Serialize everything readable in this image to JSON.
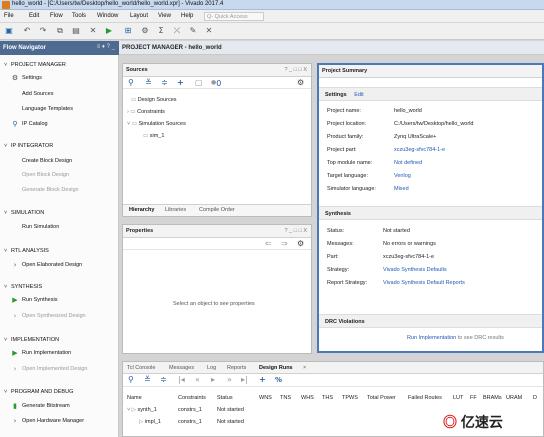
{
  "window": {
    "title": "hello_world - [C:/Users/tw/Desktop/hello_world/hello_world.xpr] - Vivado 2017.4"
  },
  "menu": {
    "items": [
      "File",
      "Edit",
      "Flow",
      "Tools",
      "Window",
      "Layout",
      "View",
      "Help"
    ],
    "search_placeholder": "Q- Quick Access"
  },
  "flow_navigator": {
    "title": "Flow Navigator",
    "controls": "≡ ♦ ? _",
    "project_manager": {
      "label": "PROJECT MANAGER",
      "settings": "Settings",
      "add_sources": "Add Sources",
      "language_templates": "Language Templates",
      "ip_catalog": "IP Catalog"
    },
    "ip_integrator": {
      "label": "IP INTEGRATOR",
      "create_block_design": "Create Block Design",
      "open_block_design": "Open Block Design",
      "generate_block_design": "Generate Block Design"
    },
    "simulation": {
      "label": "SIMULATION",
      "run_simulation": "Run Simulation"
    },
    "rtl_analysis": {
      "label": "RTL ANALYSIS",
      "open_elaborated_design": "Open Elaborated Design"
    },
    "synthesis": {
      "label": "SYNTHESIS",
      "run_synthesis": "Run Synthesis",
      "open_synthesized_design": "Open Synthesized Design"
    },
    "implementation": {
      "label": "IMPLEMENTATION",
      "run_implementation": "Run Implementation",
      "open_implemented_design": "Open Implemented Design"
    },
    "program_debug": {
      "label": "PROGRAM AND DEBUG",
      "generate_bitstream": "Generate Bitstream",
      "open_hardware_manager": "Open Hardware Manager"
    }
  },
  "main": {
    "header": "PROJECT MANAGER - hello_world"
  },
  "sources": {
    "title": "Sources",
    "window_controls": "? _ □ □ X",
    "count": "0",
    "tree": {
      "design_sources": "Design Sources",
      "constraints": "Constraints",
      "simulation_sources": "Simulation Sources",
      "sim_1": "sim_1"
    },
    "tabs": {
      "hierarchy": "Hierarchy",
      "libraries": "Libraries",
      "compile_order": "Compile Order"
    }
  },
  "properties": {
    "title": "Properties",
    "window_controls": "? _ □ □ X",
    "empty_text": "Select an object to see properties"
  },
  "project_summary": {
    "title": "Project Summary",
    "settings": {
      "label": "Settings",
      "edit": "Edit"
    },
    "rows": [
      {
        "k": "Project name:",
        "v": "hello_world"
      },
      {
        "k": "Project location:",
        "v": "C:/Users/tw/Desktop/hello_world"
      },
      {
        "k": "Product family:",
        "v": "Zynq UltraScale+"
      },
      {
        "k": "Project part:",
        "v": "xczu3eg-sfvc784-1-e"
      },
      {
        "k": "Top module name:",
        "v": "Not defined"
      },
      {
        "k": "Target language:",
        "v": "Verilog"
      },
      {
        "k": "Simulator language:",
        "v": "Mixed"
      }
    ],
    "synthesis": {
      "label": "Synthesis",
      "rows": [
        {
          "k": "Status:",
          "v": "Not started"
        },
        {
          "k": "Messages:",
          "v": "No errors or warnings"
        },
        {
          "k": "Part:",
          "v": "xczu3eg-sfvc784-1-e"
        },
        {
          "k": "Strategy:",
          "v": "Vivado Synthesis Defaults"
        },
        {
          "k": "Report Strategy:",
          "v": "Vivado Synthesis Default Reports"
        }
      ]
    },
    "drc": {
      "label": "DRC Violations",
      "link": "Run Implementation",
      "suffix": "to see DRC results"
    }
  },
  "bottom": {
    "tabs": [
      "Tcl Console",
      "Messages",
      "Log",
      "Reports",
      "Design Runs"
    ],
    "close": "×",
    "columns": [
      "Name",
      "Constraints",
      "Status",
      "WNS",
      "TNS",
      "WHS",
      "THS",
      "TPWS",
      "Total Power",
      "Failed Routes",
      "LUT",
      "FF",
      "BRAMs",
      "URAM",
      "D"
    ],
    "rows": [
      {
        "name": "synth_1",
        "constraints": "constrs_1",
        "status": "Not started"
      },
      {
        "name": "impl_1",
        "constraints": "constrs_1",
        "status": "Not started"
      }
    ]
  },
  "watermark": "亿速云",
  "colors": {
    "nav_header": "#4d6a91",
    "summary_border": "#4a78b8",
    "link": "#2158b8",
    "run_green": "#2e9a2e"
  }
}
